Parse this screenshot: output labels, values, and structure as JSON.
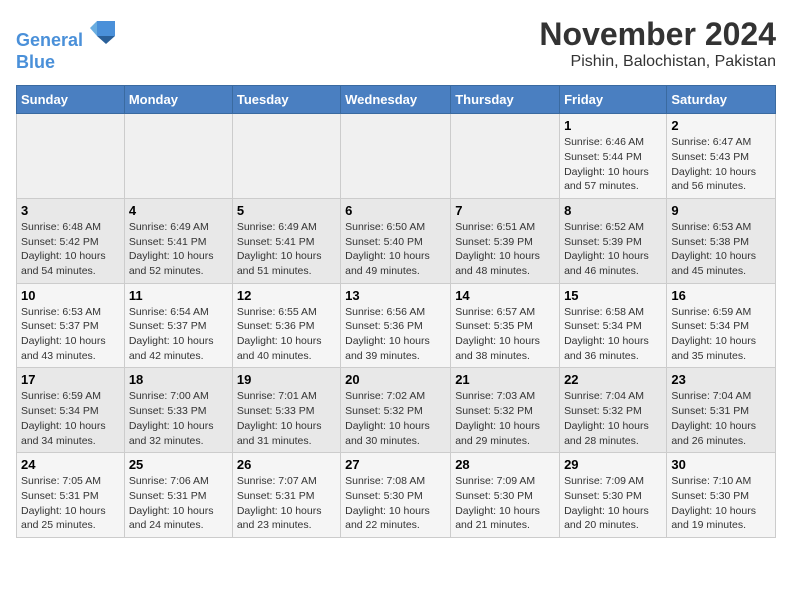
{
  "header": {
    "logo_line1": "General",
    "logo_line2": "Blue",
    "month_title": "November 2024",
    "location": "Pishin, Balochistan, Pakistan"
  },
  "days_of_week": [
    "Sunday",
    "Monday",
    "Tuesday",
    "Wednesday",
    "Thursday",
    "Friday",
    "Saturday"
  ],
  "weeks": [
    [
      {
        "day": "",
        "info": ""
      },
      {
        "day": "",
        "info": ""
      },
      {
        "day": "",
        "info": ""
      },
      {
        "day": "",
        "info": ""
      },
      {
        "day": "",
        "info": ""
      },
      {
        "day": "1",
        "info": "Sunrise: 6:46 AM\nSunset: 5:44 PM\nDaylight: 10 hours and 57 minutes."
      },
      {
        "day": "2",
        "info": "Sunrise: 6:47 AM\nSunset: 5:43 PM\nDaylight: 10 hours and 56 minutes."
      }
    ],
    [
      {
        "day": "3",
        "info": "Sunrise: 6:48 AM\nSunset: 5:42 PM\nDaylight: 10 hours and 54 minutes."
      },
      {
        "day": "4",
        "info": "Sunrise: 6:49 AM\nSunset: 5:41 PM\nDaylight: 10 hours and 52 minutes."
      },
      {
        "day": "5",
        "info": "Sunrise: 6:49 AM\nSunset: 5:41 PM\nDaylight: 10 hours and 51 minutes."
      },
      {
        "day": "6",
        "info": "Sunrise: 6:50 AM\nSunset: 5:40 PM\nDaylight: 10 hours and 49 minutes."
      },
      {
        "day": "7",
        "info": "Sunrise: 6:51 AM\nSunset: 5:39 PM\nDaylight: 10 hours and 48 minutes."
      },
      {
        "day": "8",
        "info": "Sunrise: 6:52 AM\nSunset: 5:39 PM\nDaylight: 10 hours and 46 minutes."
      },
      {
        "day": "9",
        "info": "Sunrise: 6:53 AM\nSunset: 5:38 PM\nDaylight: 10 hours and 45 minutes."
      }
    ],
    [
      {
        "day": "10",
        "info": "Sunrise: 6:53 AM\nSunset: 5:37 PM\nDaylight: 10 hours and 43 minutes."
      },
      {
        "day": "11",
        "info": "Sunrise: 6:54 AM\nSunset: 5:37 PM\nDaylight: 10 hours and 42 minutes."
      },
      {
        "day": "12",
        "info": "Sunrise: 6:55 AM\nSunset: 5:36 PM\nDaylight: 10 hours and 40 minutes."
      },
      {
        "day": "13",
        "info": "Sunrise: 6:56 AM\nSunset: 5:36 PM\nDaylight: 10 hours and 39 minutes."
      },
      {
        "day": "14",
        "info": "Sunrise: 6:57 AM\nSunset: 5:35 PM\nDaylight: 10 hours and 38 minutes."
      },
      {
        "day": "15",
        "info": "Sunrise: 6:58 AM\nSunset: 5:34 PM\nDaylight: 10 hours and 36 minutes."
      },
      {
        "day": "16",
        "info": "Sunrise: 6:59 AM\nSunset: 5:34 PM\nDaylight: 10 hours and 35 minutes."
      }
    ],
    [
      {
        "day": "17",
        "info": "Sunrise: 6:59 AM\nSunset: 5:34 PM\nDaylight: 10 hours and 34 minutes."
      },
      {
        "day": "18",
        "info": "Sunrise: 7:00 AM\nSunset: 5:33 PM\nDaylight: 10 hours and 32 minutes."
      },
      {
        "day": "19",
        "info": "Sunrise: 7:01 AM\nSunset: 5:33 PM\nDaylight: 10 hours and 31 minutes."
      },
      {
        "day": "20",
        "info": "Sunrise: 7:02 AM\nSunset: 5:32 PM\nDaylight: 10 hours and 30 minutes."
      },
      {
        "day": "21",
        "info": "Sunrise: 7:03 AM\nSunset: 5:32 PM\nDaylight: 10 hours and 29 minutes."
      },
      {
        "day": "22",
        "info": "Sunrise: 7:04 AM\nSunset: 5:32 PM\nDaylight: 10 hours and 28 minutes."
      },
      {
        "day": "23",
        "info": "Sunrise: 7:04 AM\nSunset: 5:31 PM\nDaylight: 10 hours and 26 minutes."
      }
    ],
    [
      {
        "day": "24",
        "info": "Sunrise: 7:05 AM\nSunset: 5:31 PM\nDaylight: 10 hours and 25 minutes."
      },
      {
        "day": "25",
        "info": "Sunrise: 7:06 AM\nSunset: 5:31 PM\nDaylight: 10 hours and 24 minutes."
      },
      {
        "day": "26",
        "info": "Sunrise: 7:07 AM\nSunset: 5:31 PM\nDaylight: 10 hours and 23 minutes."
      },
      {
        "day": "27",
        "info": "Sunrise: 7:08 AM\nSunset: 5:30 PM\nDaylight: 10 hours and 22 minutes."
      },
      {
        "day": "28",
        "info": "Sunrise: 7:09 AM\nSunset: 5:30 PM\nDaylight: 10 hours and 21 minutes."
      },
      {
        "day": "29",
        "info": "Sunrise: 7:09 AM\nSunset: 5:30 PM\nDaylight: 10 hours and 20 minutes."
      },
      {
        "day": "30",
        "info": "Sunrise: 7:10 AM\nSunset: 5:30 PM\nDaylight: 10 hours and 19 minutes."
      }
    ]
  ]
}
